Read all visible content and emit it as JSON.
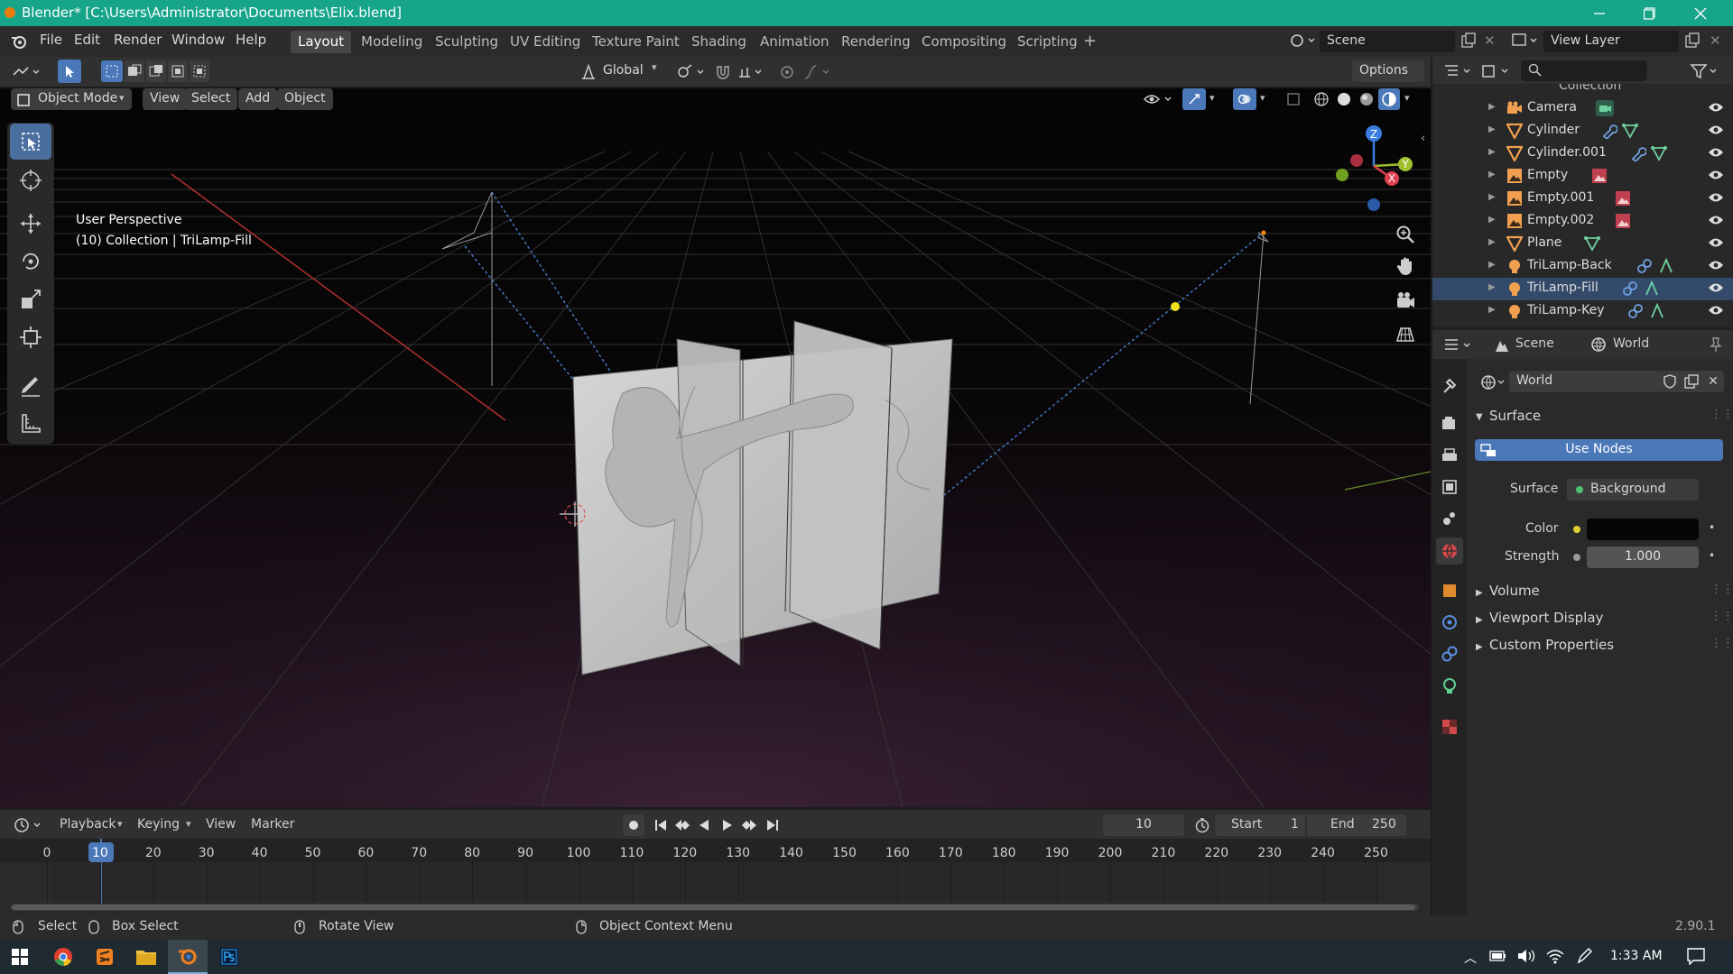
{
  "window": {
    "title": "Blender* [C:\\Users\\Administrator\\Documents\\Elix.blend]"
  },
  "menu": [
    "File",
    "Edit",
    "Render",
    "Window",
    "Help"
  ],
  "workspaces": [
    "Layout",
    "Modeling",
    "Sculpting",
    "UV Editing",
    "Texture Paint",
    "Shading",
    "Animation",
    "Rendering",
    "Compositing",
    "Scripting"
  ],
  "active_workspace": "Layout",
  "scene_field": "Scene",
  "view_layer_field": "View Layer",
  "toolbar": {
    "transform_orientation": "Global",
    "options": "Options"
  },
  "viewport_header": {
    "mode": "Object Mode",
    "view": "View",
    "select": "Select",
    "add": "Add",
    "object": "Object"
  },
  "viewport": {
    "perspective": "User Perspective",
    "collection_info": "(10) Collection | TriLamp-Fill"
  },
  "gizmo": {
    "x": "X",
    "y": "Y",
    "z": "Z"
  },
  "outliner": {
    "partial_row": "Collection",
    "items": [
      {
        "name": "Camera",
        "type": "camera"
      },
      {
        "name": "Cylinder",
        "type": "mesh"
      },
      {
        "name": "Cylinder.001",
        "type": "mesh"
      },
      {
        "name": "Empty",
        "type": "empty"
      },
      {
        "name": "Empty.001",
        "type": "empty"
      },
      {
        "name": "Empty.002",
        "type": "empty"
      },
      {
        "name": "Plane",
        "type": "mesh"
      },
      {
        "name": "TriLamp-Back",
        "type": "light"
      },
      {
        "name": "TriLamp-Fill",
        "type": "light"
      },
      {
        "name": "TriLamp-Key",
        "type": "light"
      }
    ]
  },
  "properties": {
    "breadcrumb_scene": "Scene",
    "breadcrumb_world": "World",
    "world_name": "World",
    "surface_section": "Surface",
    "use_nodes": "Use Nodes",
    "surface_label": "Surface",
    "surface_value": "Background",
    "color_label": "Color",
    "strength_label": "Strength",
    "strength_value": "1.000",
    "volume_section": "Volume",
    "viewport_display_section": "Viewport Display",
    "custom_props_section": "Custom Properties"
  },
  "timeline": {
    "playback": "Playback",
    "keying": "Keying",
    "view": "View",
    "marker": "Marker",
    "current_frame": "10",
    "start_label": "Start",
    "start_value": "1",
    "end_label": "End",
    "end_value": "250",
    "ticks": [
      "0",
      "10",
      "20",
      "30",
      "40",
      "50",
      "60",
      "70",
      "80",
      "90",
      "100",
      "110",
      "120",
      "130",
      "140",
      "150",
      "160",
      "170",
      "180",
      "190",
      "200",
      "210",
      "220",
      "230",
      "240",
      "250"
    ]
  },
  "statusbar": {
    "select": "Select",
    "box_select": "Box Select",
    "rotate_view": "Rotate View",
    "context_menu": "Object Context Menu",
    "version": "2.90.1"
  },
  "taskbar": {
    "time": "1:33 AM"
  },
  "colors": {
    "title_bar": "#17a589",
    "accent": "#4a78b8",
    "active_frame": "#4a78b8"
  }
}
